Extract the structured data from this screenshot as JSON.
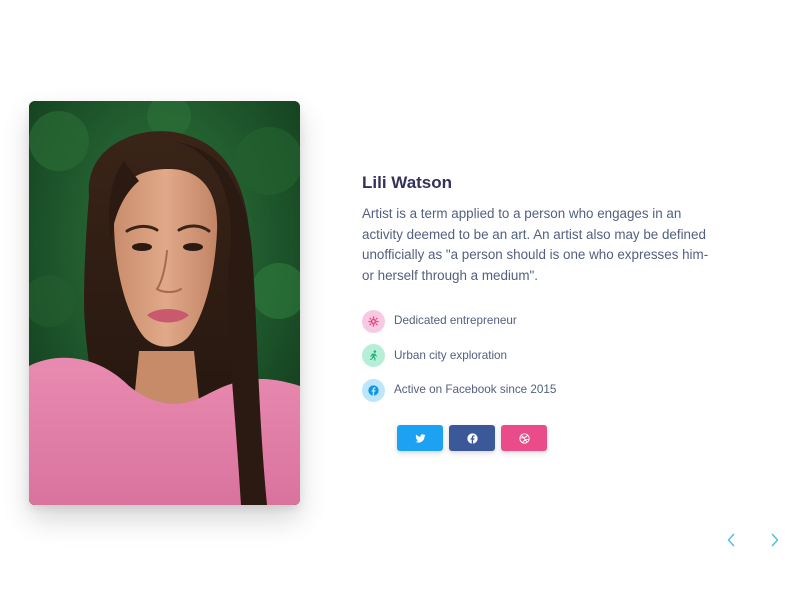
{
  "profile": {
    "name": "Lili Watson",
    "bio": "Artist is a term applied to a person who engages in an activity deemed to be an art. An artist also may be defined unofficially as \"a person should is one who expresses him- or herself through a medium\"."
  },
  "features": [
    {
      "label": "Dedicated entrepreneur",
      "icon": "settings-icon",
      "color": "#f3a4cf"
    },
    {
      "label": "Urban city exploration",
      "icon": "running-person-icon",
      "color": "#2dce89"
    },
    {
      "label": "Active on Facebook since 2015",
      "icon": "facebook-icon",
      "color": "#11cdef"
    }
  ],
  "socials": [
    {
      "name": "twitter",
      "icon": "twitter-icon",
      "color": "#1da1f2"
    },
    {
      "name": "facebook",
      "icon": "facebook-icon",
      "color": "#3b5999"
    },
    {
      "name": "dribbble",
      "icon": "dribbble-icon",
      "color": "#ea4c89"
    }
  ],
  "carousel": {
    "prev_icon": "chevron-left-icon",
    "next_icon": "chevron-right-icon",
    "arrow_color": "#5bc0de"
  },
  "colors": {
    "heading": "#32325d",
    "text": "#525f7f"
  }
}
